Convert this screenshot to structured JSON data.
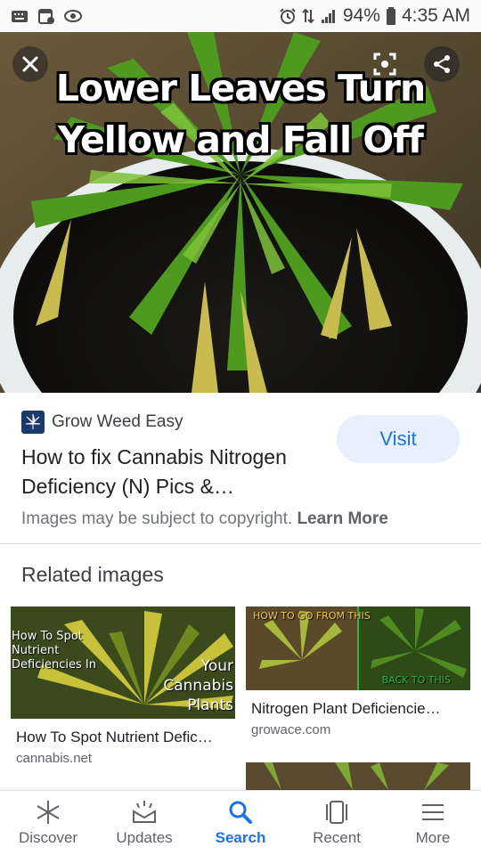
{
  "status_bar": {
    "battery": "94%",
    "time": "4:35 AM",
    "left_icons": [
      "keyboard-icon",
      "calendar-icon",
      "eye-icon"
    ],
    "right_icons": [
      "alarm-icon",
      "data-icon",
      "signal-icon",
      "battery-icon"
    ]
  },
  "hero": {
    "caption_line1": "Lower Leaves Turn",
    "caption_line2": "Yellow and Fall Off",
    "buttons": [
      "close-icon",
      "lens-icon",
      "share-icon"
    ]
  },
  "source": {
    "site_name": "Grow Weed Easy",
    "title": "How to fix Cannabis Nitrogen Deficiency (N) Pics &…",
    "visit_label": "Visit",
    "copyright_text": "Images may be subject to copyright.",
    "learn_more_label": "Learn More"
  },
  "related": {
    "heading": "Related images",
    "items": [
      {
        "title": "How To Spot Nutrient Defic…",
        "source": "cannabis.net",
        "overlay_left": [
          "How To Spot",
          "Nutrient",
          "Deficiencies In"
        ],
        "overlay_right": [
          "Your",
          "Cannabis",
          "Plants"
        ]
      },
      {
        "title": "Nitrogen Plant Deficiencie…",
        "source": "growace.com",
        "overlay_top": "HOW TO GO FROM THIS",
        "overlay_bottom": "BACK TO THIS"
      }
    ]
  },
  "bottom_nav": {
    "items": [
      {
        "label": "Discover",
        "icon": "asterisk-icon"
      },
      {
        "label": "Updates",
        "icon": "updates-icon"
      },
      {
        "label": "Search",
        "icon": "search-icon",
        "active": true
      },
      {
        "label": "Recent",
        "icon": "recent-icon"
      },
      {
        "label": "More",
        "icon": "menu-icon"
      }
    ]
  },
  "colors": {
    "accent": "#1a73e8",
    "visit_bg": "#e8f0fe",
    "text_primary": "#202124",
    "text_secondary": "#70757a"
  }
}
